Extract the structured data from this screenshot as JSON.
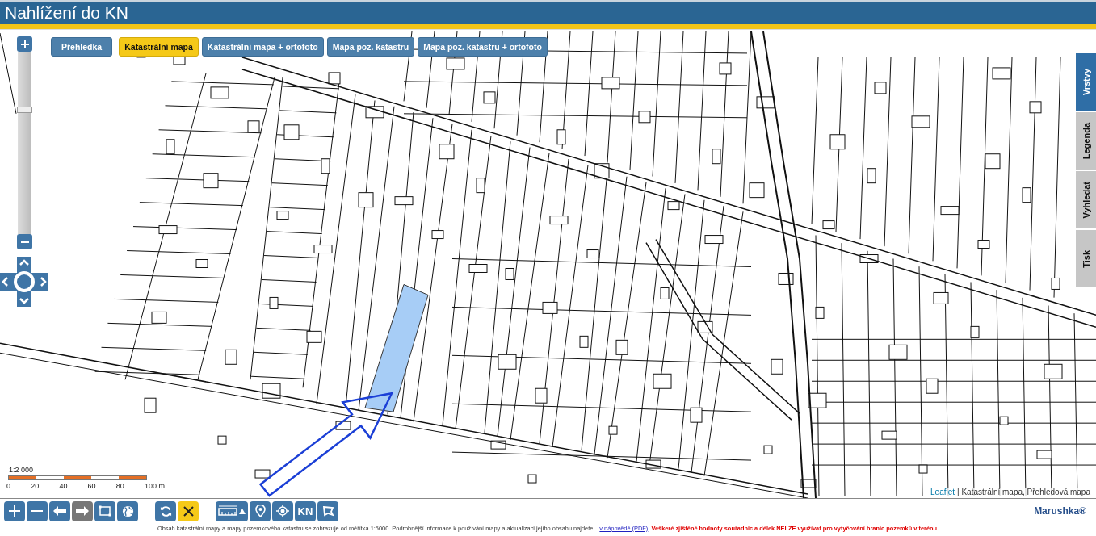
{
  "window": {
    "title": "Nahlížení do KN"
  },
  "layer_buttons": [
    {
      "label": "Přehledka",
      "selected": false
    },
    {
      "label": "Katastrální mapa",
      "selected": true
    },
    {
      "label": "Katastrální mapa + ortofoto",
      "selected": false
    },
    {
      "label": "Mapa poz. katastru",
      "selected": false
    },
    {
      "label": "Mapa poz. katastru + ortofoto",
      "selected": false
    }
  ],
  "side_tabs": [
    {
      "label": "Vrstvy",
      "selected": true
    },
    {
      "label": "Legenda",
      "selected": false
    },
    {
      "label": "Vyhledat",
      "selected": false
    },
    {
      "label": "Tisk",
      "selected": false
    }
  ],
  "zoom_slider": {
    "level": 0.7
  },
  "scale": {
    "ratio": "1:2 000",
    "ticks": [
      "0",
      "20",
      "40",
      "60",
      "80",
      "100 m"
    ]
  },
  "attribution": {
    "link": "Leaflet",
    "text": "| Katastrální mapa, Přehledová mapa"
  },
  "toolbar": {
    "groups": [
      {
        "items": [
          {
            "kind": "zoomin",
            "disabled": false,
            "active": false
          },
          {
            "kind": "zoomout",
            "disabled": false,
            "active": false
          },
          {
            "kind": "back",
            "disabled": false,
            "active": false
          },
          {
            "kind": "forward",
            "disabled": true,
            "active": false
          },
          {
            "kind": "zoombox",
            "disabled": false,
            "active": false
          },
          {
            "kind": "globe",
            "disabled": false,
            "active": false
          }
        ]
      },
      {
        "items": [
          {
            "kind": "refresh",
            "disabled": false,
            "active": false
          },
          {
            "kind": "clear",
            "disabled": false,
            "active": true
          }
        ]
      },
      {
        "items": [
          {
            "kind": "measure",
            "disabled": false,
            "active": false
          },
          {
            "kind": "pin",
            "disabled": false,
            "active": false
          },
          {
            "kind": "locate",
            "disabled": false,
            "active": false
          },
          {
            "kind": "text",
            "label": "KN",
            "disabled": false,
            "active": false
          },
          {
            "kind": "shape",
            "disabled": false,
            "active": false
          }
        ]
      }
    ]
  },
  "logo": "Marushka®",
  "footer": {
    "notice": "Obsah katastrální mapy a mapy pozemkového katastru se zobrazuje od měřítka 1:5000. Podrobnější informace k používání mapy a aktualizaci jejího obsahu najdete",
    "link": "v nápovědě (PDF)",
    "link_suffix": ".",
    "warning": "Veškeré zjištěné hodnoty souřadnic a délek NELZE využívat pro vytyčování hranic pozemků v terénu."
  }
}
